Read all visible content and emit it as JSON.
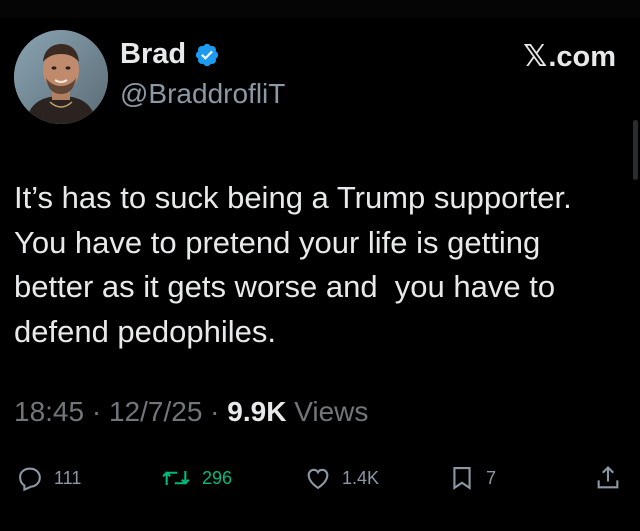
{
  "author": {
    "display_name": "Brad",
    "handle": "@BraddrofliT",
    "verified": true,
    "avatar": "profile-photo"
  },
  "site": {
    "logo": "x-logo",
    "domain": ".com"
  },
  "tweet": {
    "text": "It’s has to suck being a Trump supporter. You have to pretend your life is getting better as it gets worse and  you have to defend pedophiles."
  },
  "meta": {
    "time": "18:45",
    "sep1": " · ",
    "date": "12/7/25",
    "sep2": " · ",
    "views_count": "9.9K",
    "views_label": "Views"
  },
  "actions": {
    "replies": "111",
    "retweets": "296",
    "likes": "1.4K",
    "bookmarks": "7"
  },
  "colors": {
    "background": "#000000",
    "text": "#e7e9ea",
    "secondary": "#71767b",
    "verified": "#1d9bf0",
    "retweet": "#00ba7c"
  }
}
